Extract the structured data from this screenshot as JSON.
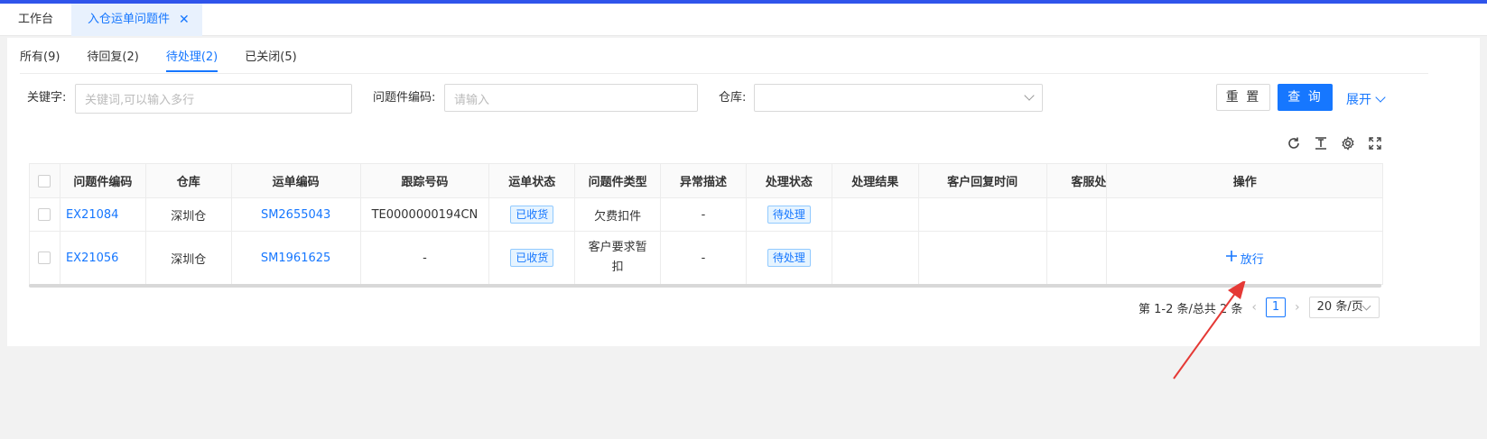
{
  "tabs": [
    {
      "label": "工作台"
    },
    {
      "label": "入仓运单问题件",
      "close": "✕"
    }
  ],
  "subtabs": [
    "所有(9)",
    "待回复(2)",
    "待处理(2)",
    "已关闭(5)"
  ],
  "filters": {
    "keyword_label": "关键字:",
    "keyword_placeholder": "关键词,可以输入多行",
    "code_label": "问题件编码:",
    "code_placeholder": "请输入",
    "warehouse_label": "仓库:",
    "warehouse_value": ""
  },
  "buttons": {
    "reset": "重 置",
    "query": "查 询",
    "expand": "展开"
  },
  "table": {
    "headers": [
      "问题件编码",
      "仓库",
      "运单编码",
      "跟踪号码",
      "运单状态",
      "问题件类型",
      "异常描述",
      "处理状态",
      "处理结果",
      "客户回复时间",
      "客服处",
      "操作"
    ],
    "rows": [
      {
        "code": "EX21084",
        "warehouse": "深圳仓",
        "waybill": "SM2655043",
        "tracking": "TE0000000194CN",
        "status": "已收货",
        "type": "欠费扣件",
        "desc": "-",
        "proc": "待处理",
        "result": "",
        "reply": "",
        "cs": "",
        "op": ""
      },
      {
        "code": "EX21056",
        "warehouse": "深圳仓",
        "waybill": "SM1961625",
        "tracking": "-",
        "status": "已收货",
        "type": "客户要求暂扣",
        "desc": "-",
        "proc": "待处理",
        "result": "",
        "reply": "",
        "cs": "",
        "op": "放行"
      }
    ]
  },
  "pagination": {
    "summary": "第 1-2 条/总共 2 条",
    "current": "1",
    "page_size": "20 条/页"
  },
  "colors": {
    "accent": "#1677ff",
    "topbar": "#2f54eb",
    "annotation": "#e53935"
  }
}
